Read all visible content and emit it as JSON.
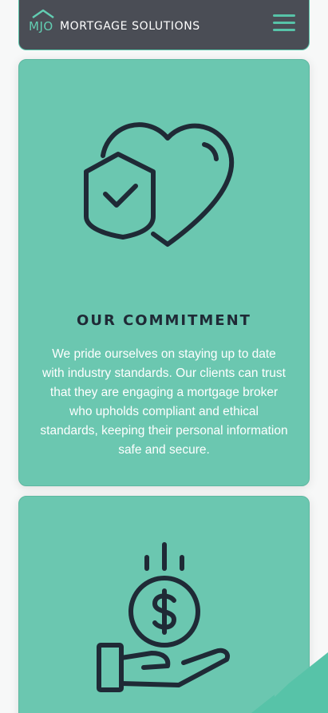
{
  "header": {
    "logo_initials": "MJO",
    "logo_name": "MORTGAGE SOLUTIONS",
    "menu_icon": "hamburger-menu-icon"
  },
  "cards": [
    {
      "icon": "heart-shield-check-icon",
      "title": "OUR COMMITMENT",
      "text": "We pride ourselves on staying up to date with industry standards. Our clients can trust that they are engaging a mortgage broker who upholds compliant and ethical standards, keeping their personal information safe and secure."
    },
    {
      "icon": "hand-dollar-coin-icon"
    }
  ],
  "colors": {
    "header_bg": "#4a4d55",
    "accent": "#57c3a8",
    "card_bg": "#6bc7b0",
    "icon_stroke": "#1f2a36",
    "title_text": "#1f2a36",
    "body_text": "#ffffff"
  }
}
